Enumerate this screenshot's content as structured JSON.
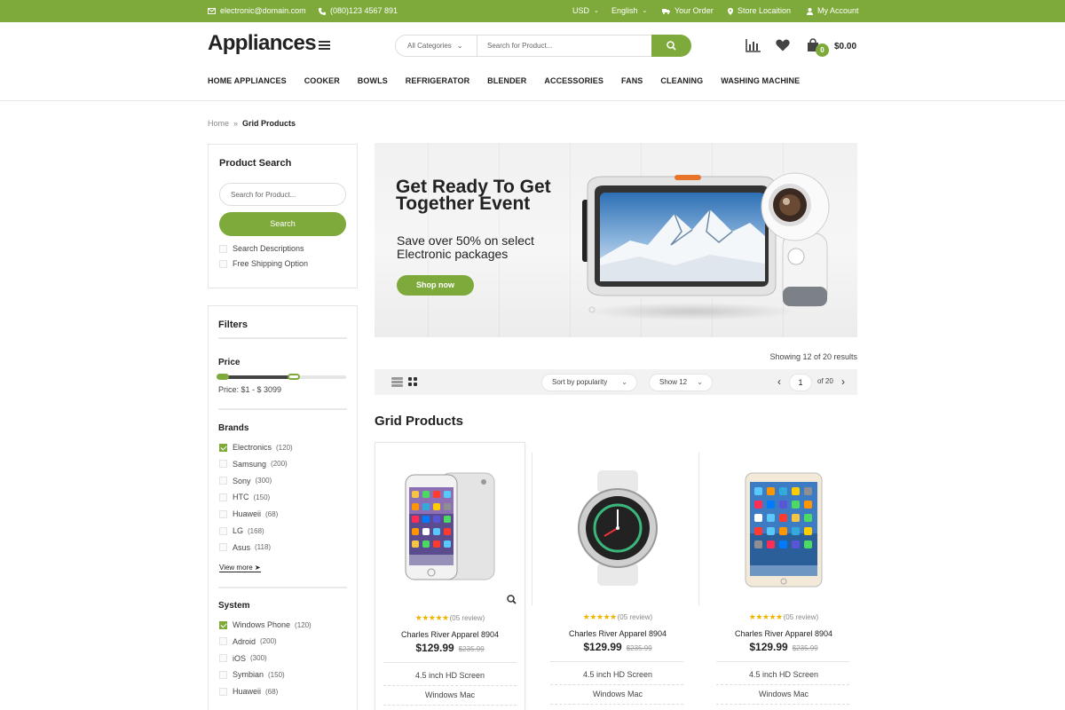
{
  "topbar": {
    "email": "electronic@domain.com",
    "phone": "(080)123 4567 891",
    "currency": "USD",
    "language": "English",
    "order": "Your Order",
    "store": "Store Locaition",
    "account": "My Account"
  },
  "header": {
    "logo": "Appliances",
    "search_category": "All Categories",
    "search_placeholder": "Search for Product...",
    "cart_count": "0",
    "cart_total": "$0.00"
  },
  "nav": [
    "HOME APPLIANCES",
    "COOKER",
    "BOWLS",
    "REFRIGERATOR",
    "BLENDER",
    "ACCESSORIES",
    "FANS",
    "CLEANING",
    "WASHING MACHINE"
  ],
  "breadcrumb": {
    "home": "Home",
    "sep": "»",
    "current": "Grid Products"
  },
  "product_search": {
    "title": "Product Search",
    "placeholder": "Search for Product...",
    "button": "Search",
    "options": [
      "Search Descriptions",
      "Free Shipping Option"
    ]
  },
  "filters": {
    "title": "Filters",
    "price_title": "Price",
    "price_label": "Price: $1 - $ 3099",
    "price_range_fraction": [
      0.0,
      0.58
    ],
    "brands_title": "Brands",
    "brands": [
      {
        "name": "Electronics",
        "count": "(120)",
        "checked": true
      },
      {
        "name": "Samsung",
        "count": "(200)",
        "checked": false
      },
      {
        "name": "Sony",
        "count": "(300)",
        "checked": false
      },
      {
        "name": "HTC",
        "count": "(150)",
        "checked": false
      },
      {
        "name": "Huaweii",
        "count": "(68)",
        "checked": false
      },
      {
        "name": "LG",
        "count": "(168)",
        "checked": false
      },
      {
        "name": "Asus",
        "count": "(118)",
        "checked": false
      }
    ],
    "view_more": "View more",
    "system_title": "System",
    "systems": [
      {
        "name": "Windows Phone",
        "count": "(120)",
        "checked": true
      },
      {
        "name": "Adroid",
        "count": "(200)",
        "checked": false
      },
      {
        "name": "iOS",
        "count": "(300)",
        "checked": false
      },
      {
        "name": "Symbian",
        "count": "(150)",
        "checked": false
      },
      {
        "name": "Huaweii",
        "count": "(68)",
        "checked": false
      }
    ]
  },
  "banner": {
    "headline": "Get Ready To Get Together Event",
    "subline": "Save over 50% on select Electronic packages",
    "button": "Shop now"
  },
  "toolbar": {
    "results": "Showing 12 of 20 results",
    "sort": "Sort by popularity",
    "show": "Show 12",
    "page": "1",
    "of": "of 20"
  },
  "grid_title": "Grid Products",
  "products": [
    {
      "image": "phone",
      "stars": "★★★★★",
      "reviews": "(05 review)",
      "name": "Charles River Apparel 8904",
      "price": "$129.99",
      "old_price": "$235.99",
      "spec1": "4.5 inch HD Screen",
      "spec2": "Windows Mac"
    },
    {
      "image": "watch",
      "stars": "★★★★★",
      "reviews": "(05 review)",
      "name": "Charles River Apparel 8904",
      "price": "$129.99",
      "old_price": "$235.99",
      "spec1": "4.5 inch HD Screen",
      "spec2": "Windows Mac"
    },
    {
      "image": "tablet",
      "stars": "★★★★★",
      "reviews": "(05 review)",
      "name": "Charles River Apparel 8904",
      "price": "$129.99",
      "old_price": "$235.99",
      "spec1": "4.5 inch HD Screen",
      "spec2": "Windows Mac"
    }
  ],
  "colors": {
    "accent": "#7eaa3b",
    "text": "#222222",
    "star": "#f0b400"
  }
}
